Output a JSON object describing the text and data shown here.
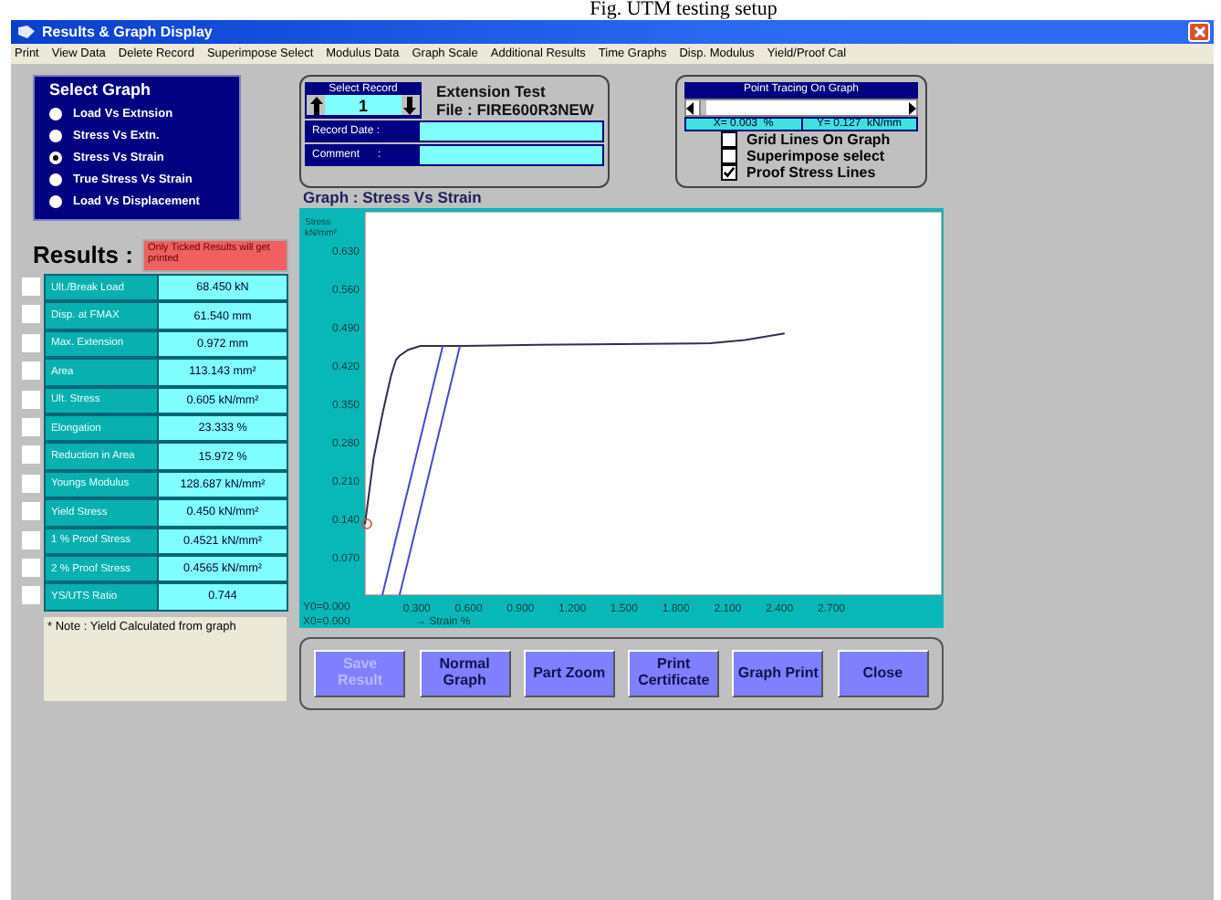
{
  "caption": "Fig. UTM testing setup",
  "window": {
    "title": "Results & Graph Display"
  },
  "menu": [
    "Print",
    "View Data",
    "Delete Record",
    "Superimpose Select",
    "Modulus Data",
    "Graph Scale",
    "Additional Results",
    "Time Graphs",
    "Disp. Modulus",
    "Yield/Proof Cal"
  ],
  "select_graph": {
    "title": "Select Graph",
    "options": [
      {
        "label": "Load Vs Extnsion",
        "selected": false
      },
      {
        "label": "Stress Vs Extn.",
        "selected": false
      },
      {
        "label": "Stress Vs Strain",
        "selected": true
      },
      {
        "label": "True Stress Vs Strain",
        "selected": false
      },
      {
        "label": "Load Vs Displacement",
        "selected": false
      }
    ]
  },
  "record": {
    "select_label": "Select Record",
    "number": "1",
    "test_name": "Extension Test",
    "file": "File : FIRE600R3NEW",
    "date_label": "Record Date :",
    "comment_label": "Comment      :"
  },
  "point_tracing": {
    "title": "Point Tracing On Graph",
    "x": "X= 0.003  %",
    "y": "Y= 0.127  kN/mm"
  },
  "options": [
    {
      "label": "Grid Lines On Graph",
      "checked": false
    },
    {
      "label": "Superimpose select",
      "checked": false
    },
    {
      "label": "Proof Stress Lines",
      "checked": true
    }
  ],
  "results": {
    "title": "Results :",
    "note": "Only Ticked Results will get printed",
    "rows": [
      {
        "name": "Ult./Break Load",
        "value": "68.450  kN",
        "checked": false
      },
      {
        "name": "Disp. at FMAX",
        "value": "61.540  mm",
        "checked": false
      },
      {
        "name": "Max. Extension",
        "value": "0.972  mm",
        "checked": false
      },
      {
        "name": "Area",
        "value": "113.143  mm²",
        "checked": false
      },
      {
        "name": "Ult. Stress",
        "value": "0.605  kN/mm²",
        "checked": false
      },
      {
        "name": "Elongation",
        "value": "23.333  %",
        "checked": false
      },
      {
        "name": "Reduction in Area",
        "value": "15.972  %",
        "checked": false
      },
      {
        "name": "Youngs Modulus",
        "value": "128.687  kN/mm²",
        "checked": false
      },
      {
        "name": "Yield Stress",
        "value": "0.450  kN/mm²",
        "checked": false
      },
      {
        "name": "1 % Proof Stress",
        "value": "0.4521  kN/mm²",
        "checked": false
      },
      {
        "name": "2 % Proof Stress",
        "value": "0.4565  kN/mm²",
        "checked": false
      },
      {
        "name": "YS/UTS Ratio",
        "value": "0.744",
        "checked": false
      }
    ]
  },
  "footnote": "* Note : Yield Calculated from graph",
  "graph": {
    "title": "Graph :  Stress Vs Strain",
    "origin_y": "Y0=0.000",
    "origin_x": "X0=0.000",
    "chart_data": {
      "type": "line",
      "xlabel": "→ Strain  %",
      "ylabel": "Stress kN/mm²",
      "xlim": [
        0,
        3.35
      ],
      "ylim": [
        0,
        0.7
      ],
      "xticks": [
        {
          "value": 0.3,
          "label": "0.300"
        },
        {
          "value": 0.6,
          "label": "0.600"
        },
        {
          "value": 0.9,
          "label": "0.900"
        },
        {
          "value": 1.2,
          "label": "1.200"
        },
        {
          "value": 1.5,
          "label": "1.500"
        },
        {
          "value": 1.8,
          "label": "1.800"
        },
        {
          "value": 2.1,
          "label": "2.100"
        },
        {
          "value": 2.4,
          "label": "2.400"
        },
        {
          "value": 2.7,
          "label": "2.700"
        }
      ],
      "yticks": [
        {
          "value": 0.07,
          "label": "0.070"
        },
        {
          "value": 0.14,
          "label": "0.140"
        },
        {
          "value": 0.21,
          "label": "0.210"
        },
        {
          "value": 0.28,
          "label": "0.280"
        },
        {
          "value": 0.35,
          "label": "0.350"
        },
        {
          "value": 0.42,
          "label": "0.420"
        },
        {
          "value": 0.49,
          "label": "0.490"
        },
        {
          "value": 0.56,
          "label": "0.560"
        },
        {
          "value": 0.63,
          "label": "0.630"
        }
      ],
      "x": [
        0,
        0.05,
        0.1,
        0.15,
        0.18,
        0.2,
        0.25,
        0.32,
        0.45,
        0.55,
        1.0,
        2.0,
        2.2,
        2.43
      ],
      "series": [
        {
          "color": "#303050",
          "values": [
            0.13,
            0.25,
            0.33,
            0.4,
            0.43,
            0.437,
            0.448,
            0.455,
            0.455,
            0.455,
            0.457,
            0.46,
            0.466,
            0.478
          ]
        },
        {
          "color": "#4848d0",
          "values": [
            null,
            null,
            0,
            0.065,
            0.104,
            0.13,
            0.195,
            0.286,
            0.455,
            null,
            null,
            null,
            null,
            null
          ]
        },
        {
          "color": "#4848d0",
          "values": [
            null,
            null,
            null,
            null,
            null,
            0,
            0.065,
            0.156,
            0.325,
            0.455,
            null,
            null,
            null,
            null
          ]
        }
      ]
    }
  },
  "buttons": [
    {
      "label": "Save Result",
      "disabled": true
    },
    {
      "label": "Normal Graph",
      "disabled": false
    },
    {
      "label": "Part Zoom",
      "disabled": false
    },
    {
      "label": "Print Certificate",
      "disabled": false
    },
    {
      "label": "Graph Print",
      "disabled": false
    },
    {
      "label": "Close",
      "disabled": false
    }
  ]
}
